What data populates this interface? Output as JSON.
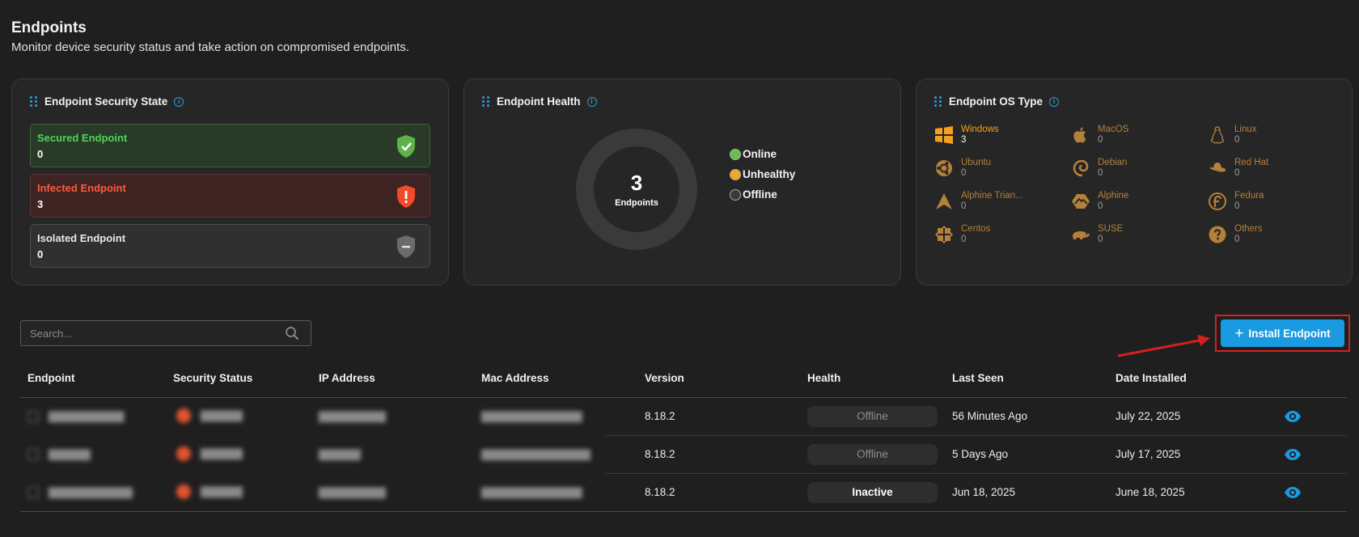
{
  "page": {
    "title": "Endpoints",
    "subtitle": "Monitor device security status and take action on compromised endpoints."
  },
  "security_card": {
    "title": "Endpoint Security State",
    "items": [
      {
        "label": "Secured Endpoint",
        "value": "0",
        "color": "#4ed45a",
        "icon": "check-shield-icon"
      },
      {
        "label": "Infected Endpoint",
        "value": "3",
        "color": "#ff5b3f",
        "icon": "alert-shield-icon"
      },
      {
        "label": "Isolated Endpoint",
        "value": "0",
        "color": "#8a8a8a",
        "icon": "minus-shield-icon"
      }
    ]
  },
  "health_card": {
    "title": "Endpoint Health",
    "total": "3",
    "total_label": "Endpoints",
    "legend": [
      {
        "label": "Online",
        "color": "#6abf4b"
      },
      {
        "label": "Unhealthy",
        "color": "#f5a623"
      },
      {
        "label": "Offline",
        "color": "#3a3a3a"
      }
    ]
  },
  "os_card": {
    "title": "Endpoint OS Type",
    "items": [
      {
        "name": "Windows",
        "count": "3",
        "icon": "windows-icon"
      },
      {
        "name": "MacOS",
        "count": "0",
        "icon": "apple-icon"
      },
      {
        "name": "Linux",
        "count": "0",
        "icon": "linux-icon"
      },
      {
        "name": "Ubuntu",
        "count": "0",
        "icon": "ubuntu-icon"
      },
      {
        "name": "Debian",
        "count": "0",
        "icon": "debian-icon"
      },
      {
        "name": "Red Hat",
        "count": "0",
        "icon": "redhat-icon"
      },
      {
        "name": "Alphine Trian...",
        "count": "0",
        "icon": "alpine-triangle-icon"
      },
      {
        "name": "Alphine",
        "count": "0",
        "icon": "alpine-icon"
      },
      {
        "name": "Fedura",
        "count": "0",
        "icon": "fedora-icon"
      },
      {
        "name": "Centos",
        "count": "0",
        "icon": "centos-icon"
      },
      {
        "name": "SUSE",
        "count": "0",
        "icon": "suse-icon"
      },
      {
        "name": "Others",
        "count": "0",
        "icon": "question-icon"
      }
    ]
  },
  "toolbar": {
    "search_placeholder": "Search...",
    "install_label": "Install Endpoint"
  },
  "table": {
    "columns": [
      "Endpoint",
      "Security Status",
      "IP Address",
      "Mac Address",
      "Version",
      "Health",
      "Last Seen",
      "Date Installed"
    ],
    "rows": [
      {
        "version": "8.18.2",
        "health": "Offline",
        "last_seen": "56 Minutes Ago",
        "date_installed": "July 22, 2025"
      },
      {
        "version": "8.18.2",
        "health": "Offline",
        "last_seen": "5 Days Ago",
        "date_installed": "July 17, 2025"
      },
      {
        "version": "8.18.2",
        "health": "Inactive",
        "last_seen": "Jun 18, 2025",
        "date_installed": "June 18, 2025"
      }
    ]
  },
  "colors": {
    "accent": "#1a9ae0",
    "os_label": "#f4a21e",
    "highlight": "#d81e1e"
  }
}
